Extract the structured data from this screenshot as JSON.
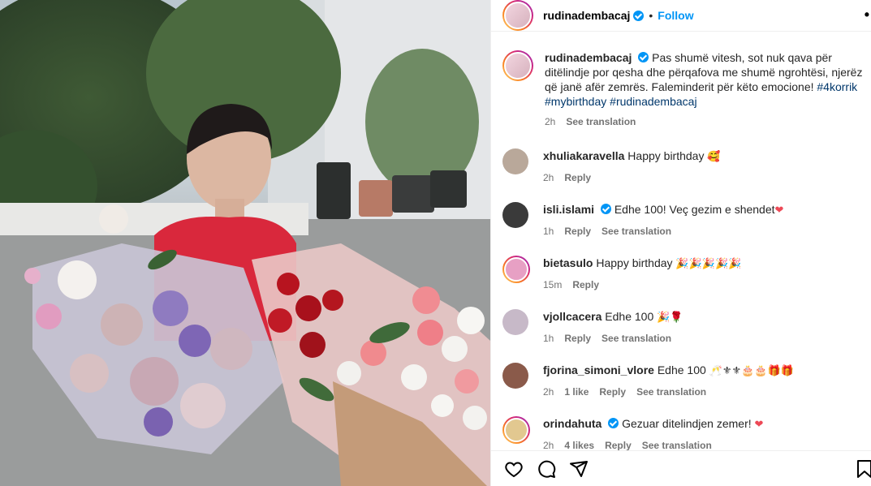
{
  "header": {
    "username": "rudinadembacaj",
    "separator": "•",
    "follow_label": "Follow",
    "more_label": "•••"
  },
  "caption": {
    "username": "rudinadembacaj",
    "text": "Pas shumë vitesh, sot nuk qava për ditëlindje por qesha dhe përqafova me shumë ngrohtësi, njerëz që janë afër zemrës. Faleminderit për këto emocione!",
    "hashtags": [
      "#4korrik",
      "#mybirthday",
      "#rudinadembacaj"
    ],
    "time": "2h",
    "see_translation": "See translation"
  },
  "comments": [
    {
      "username": "xhuliakaravella",
      "verified": false,
      "text": "Happy birthday",
      "emoji": "🥰",
      "time": "2h",
      "likes": "",
      "reply": "Reply",
      "translation": "",
      "avatar_color": "#b9a89a"
    },
    {
      "username": "isli.islami",
      "verified": true,
      "text": "Edhe 100! Veç gezim e shendet",
      "emoji": "❤",
      "time": "1h",
      "likes": "",
      "reply": "Reply",
      "translation": "See translation",
      "avatar_color": "#3a3a3a"
    },
    {
      "username": "bietasulo",
      "verified": false,
      "text": "Happy birthday",
      "emoji": "🎉🎉🎉🎉🎉",
      "time": "15m",
      "likes": "",
      "reply": "Reply",
      "translation": "",
      "avatar_color": "#e7a0c4"
    },
    {
      "username": "vjollcacera",
      "verified": false,
      "text": "Edhe 100",
      "emoji": "🎉🌹",
      "time": "1h",
      "likes": "",
      "reply": "Reply",
      "translation": "See translation",
      "avatar_color": "#c7b9c8"
    },
    {
      "username": "fjorina_simoni_vlore",
      "verified": false,
      "text": "Edhe 100",
      "emoji": "🥂⚜⚜🎂🎂🎁🎁",
      "time": "2h",
      "likes": "1 like",
      "reply": "Reply",
      "translation": "See translation",
      "avatar_color": "#8a5a4a"
    },
    {
      "username": "orindahuta",
      "verified": true,
      "text": "Gezuar ditelindjen zemer!",
      "emoji": "❤",
      "time": "2h",
      "likes": "4 likes",
      "reply": "Reply",
      "translation": "See translation",
      "avatar_color": "#e2c890"
    }
  ],
  "footer": {
    "icons": [
      "heart-icon",
      "comment-icon",
      "share-icon",
      "bookmark-icon"
    ]
  },
  "colors": {
    "accent": "#0095f6",
    "hashtag": "#00376b",
    "meta": "#737373",
    "heart": "#ed4956"
  }
}
